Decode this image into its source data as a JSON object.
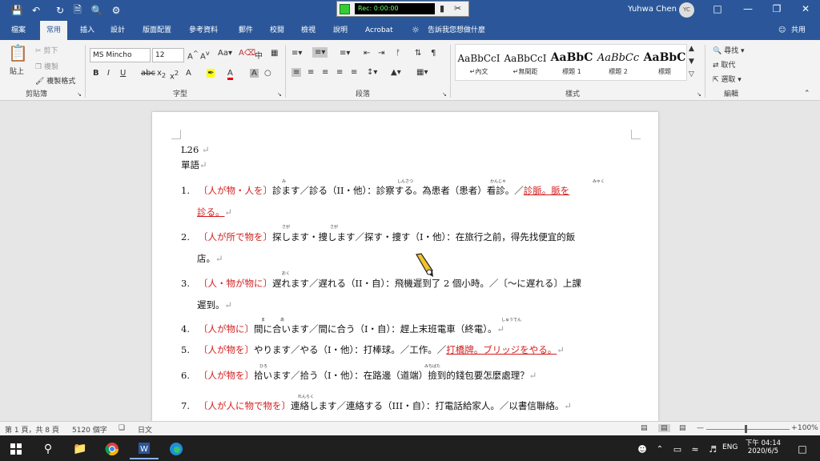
{
  "titlebar": {
    "recorder_time": "Rec: 0:00:00",
    "user_name": "Yuhwa Chen",
    "avatar_initials": "YC"
  },
  "menu": {
    "tabs": [
      "檔案",
      "常用",
      "插入",
      "設計",
      "版面配置",
      "參考資料",
      "郵件",
      "校閱",
      "檢視",
      "說明",
      "Acrobat",
      "告訴我您想做什麼"
    ],
    "share": "共用"
  },
  "ribbon": {
    "clipboard": {
      "paste": "貼上",
      "cut": "剪下",
      "copy": "複製",
      "format_painter": "複製格式",
      "group": "剪貼簿"
    },
    "font": {
      "name": "MS Mincho",
      "size": "12",
      "group": "字型"
    },
    "paragraph": {
      "group": "段落"
    },
    "styles": {
      "group": "樣式",
      "items": [
        {
          "preview": "AaBbCcI",
          "name": "↵內文"
        },
        {
          "preview": "AaBbCcI",
          "name": "↵無間距"
        },
        {
          "preview": "AaBbC",
          "name": "標題 1"
        },
        {
          "preview": "AaBbCc",
          "name": "標題 2"
        },
        {
          "preview": "AaBbC",
          "name": "標題"
        }
      ]
    },
    "editing": {
      "find": "尋找",
      "replace": "取代",
      "select": "選取",
      "group": "編輯"
    }
  },
  "doc": {
    "lesson": "L26",
    "section": "單語",
    "items": [
      {
        "num": "1.",
        "line1_red": "〔人が物・人を〕",
        "line1": "診ます／診る（II・他）：診察する。為患者（患者）看診。／",
        "line1_u": "診脈。脈を",
        "line2_u": "診る。"
      },
      {
        "num": "2.",
        "line1_red": "〔人が所で物を〕",
        "line1": "探します・捜します／探す・捜す（I・他）：在旅行之前，得先找便宜的飯",
        "line2": "店。"
      },
      {
        "num": "3.",
        "line1_red": "〔人・物が物に〕",
        "line1": "遅れます／遅れる（II・自）：飛機遲到了 2 個小時。／〔～に遅れる〕上課",
        "line2": "遲到。"
      },
      {
        "num": "4.",
        "line1_red": "〔人が物に〕",
        "line1": "間に合います／間に合う（I・自）：趕上末班電車（終電）。"
      },
      {
        "num": "5.",
        "line1_red": "〔人が物を〕",
        "line1": "やります／やる（I・他）：打棒球。／工作。／",
        "line1_u": "打橋牌。ブリッジをやる。"
      },
      {
        "num": "6.",
        "line1_red": "〔人が物を〕",
        "line1": "拾います／拾う（I・他）：在路邊（道端）撿到的錢包要怎麼處理？"
      },
      {
        "num": "7.",
        "line1_red": "〔人が人に物で物を〕",
        "line1": "連絡します／連絡する（III・自）：打電話給家人。／以書信聯絡。"
      }
    ],
    "ruby": [
      "み",
      "しんさつ",
      "かんじゃ",
      "みゃく",
      "さが",
      "さが",
      "おく",
      "ま",
      "あ",
      "しゅうでん",
      "ひろ",
      "みちばた",
      "れんらく"
    ]
  },
  "status": {
    "page": "第 1 頁，共 8 頁",
    "words": "5120 個字",
    "lang": "日文",
    "zoom": "100%"
  },
  "taskbar": {
    "lang": "ENG",
    "time": "下午 04:14",
    "date": "2020/6/5"
  }
}
